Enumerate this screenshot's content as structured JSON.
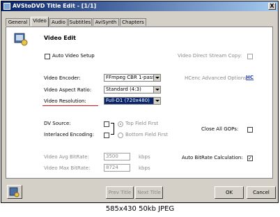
{
  "window": {
    "title": "AVStoDVD Title Edit - [1/1]",
    "close_label": "X"
  },
  "tabs": [
    {
      "label": "General"
    },
    {
      "label": "Video"
    },
    {
      "label": "Audio"
    },
    {
      "label": "Subtitles"
    },
    {
      "label": "AviSynth"
    },
    {
      "label": "Chapters"
    }
  ],
  "active_tab": "Video",
  "section": {
    "title": "Video Edit"
  },
  "auto_video_setup": {
    "label": "Auto Video Setup",
    "checked": false
  },
  "direct_stream_copy": {
    "label": "Video Direct Stream Copy:",
    "checked": false
  },
  "encoder": {
    "label": "Video Encoder:",
    "value": "FFmpeg CBR 1-pass"
  },
  "hcenc": {
    "label": "HCenc Advanced Options:",
    "link": "HC"
  },
  "aspect": {
    "label": "Video Aspect Ratio:",
    "value": "Standard (4:3)"
  },
  "resolution": {
    "label": "Video Resolution:",
    "value": "Full-D1 (720x480)"
  },
  "dv_source": {
    "label": "DV Source:",
    "checked": false
  },
  "interlaced": {
    "label": "Interlaced Encoding:",
    "checked": false
  },
  "field_order": {
    "top": "Top Field First",
    "bottom": "Bottom Field First",
    "selected": "top"
  },
  "close_gops": {
    "label": "Close All GOPs:",
    "checked": false
  },
  "avg_bitrate": {
    "label": "Video Avg BitRate:",
    "value": "3500",
    "unit": "kbps"
  },
  "max_bitrate": {
    "label": "Video Max BitRate:",
    "value": "8724",
    "unit": "kbps"
  },
  "auto_bitrate": {
    "label": "Auto BitRate Calculation:",
    "checked": true,
    "mark": "✓"
  },
  "buttons": {
    "prev": "Prev Title",
    "next": "Next Title",
    "ok": "OK",
    "cancel": "Cancel"
  },
  "caption": "585x430 50kb JPEG",
  "colors": {
    "title_start": "#0a246a",
    "title_end": "#a6caf0",
    "underline": "#e0101a",
    "highlight": "#0a246a"
  }
}
